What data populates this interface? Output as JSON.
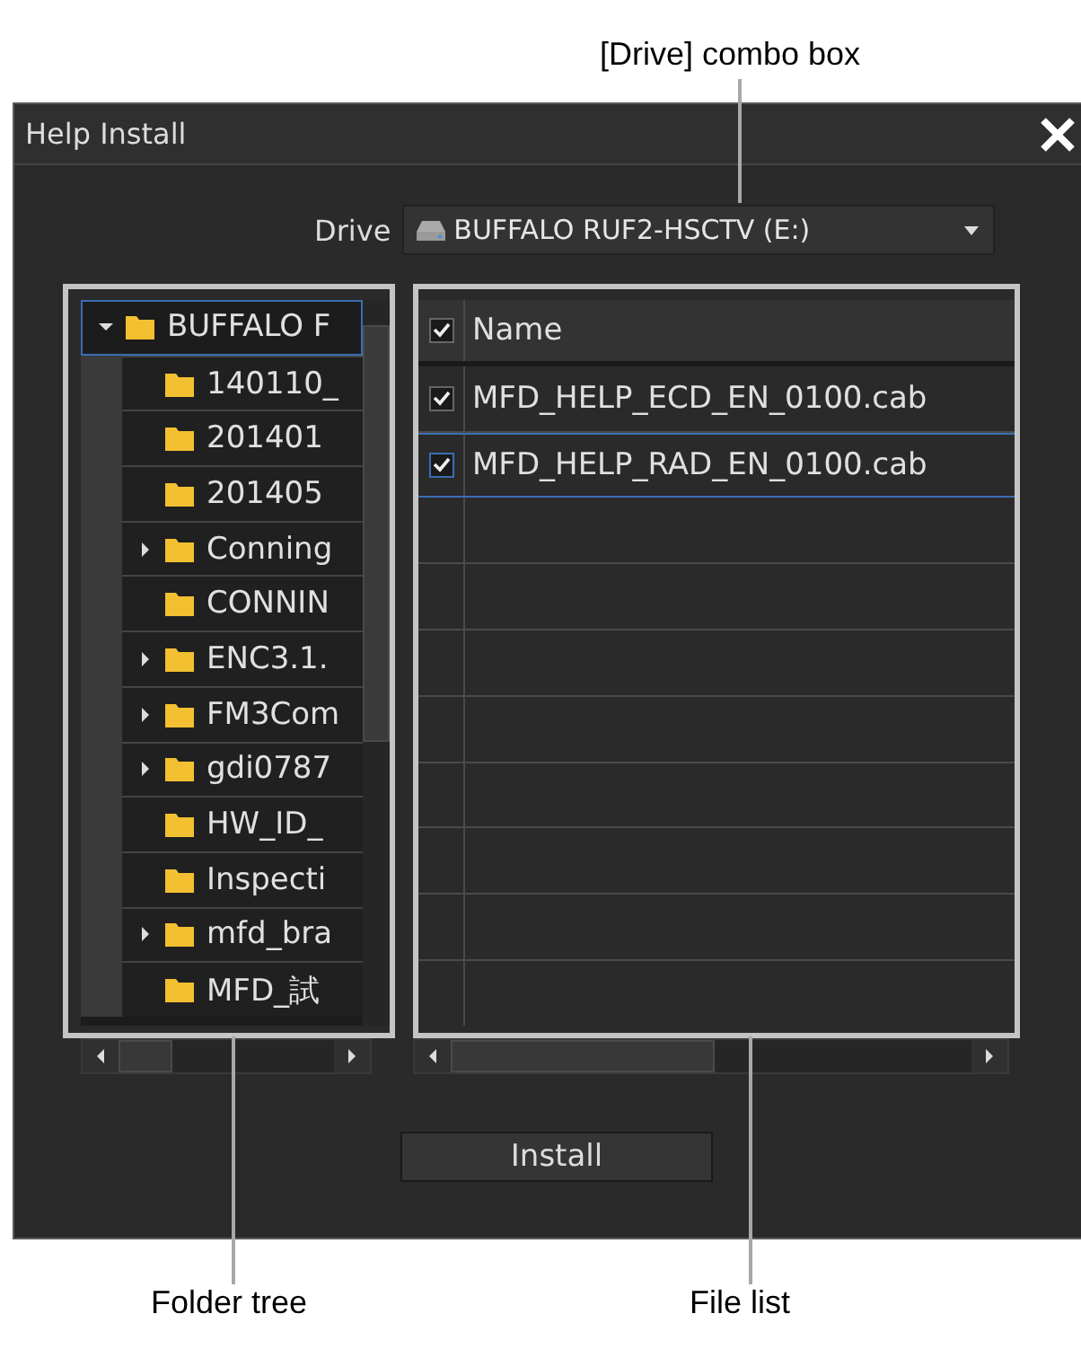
{
  "callouts": {
    "drive": "[Drive] combo box",
    "folder_tree": "Folder tree",
    "file_list": "File list"
  },
  "window": {
    "title": "Help Install"
  },
  "drive": {
    "label": "Drive",
    "value": "BUFFALO RUF2-HSCTV (E:)"
  },
  "folder_tree": {
    "items": [
      {
        "label": "BUFFALO F",
        "expandable": true,
        "expanded": true,
        "selected": true,
        "children": [
          {
            "label": "140110_",
            "expandable": false,
            "selected": false
          },
          {
            "label": "201401",
            "expandable": false,
            "selected": false
          },
          {
            "label": "201405",
            "expandable": false,
            "selected": false
          },
          {
            "label": "Conning",
            "expandable": true,
            "selected": false
          },
          {
            "label": "CONNIN",
            "expandable": false,
            "selected": false
          },
          {
            "label": "ENC3.1.",
            "expandable": true,
            "selected": false
          },
          {
            "label": "FM3Com",
            "expandable": true,
            "selected": false
          },
          {
            "label": "gdi0787",
            "expandable": true,
            "selected": false
          },
          {
            "label": "HW_ID_",
            "expandable": false,
            "selected": false
          },
          {
            "label": "Inspecti",
            "expandable": false,
            "selected": false
          },
          {
            "label": "mfd_bra",
            "expandable": true,
            "selected": false
          },
          {
            "label": "MFD_試",
            "expandable": false,
            "selected": false
          }
        ]
      }
    ]
  },
  "file_list": {
    "header": {
      "label": "Name",
      "checked": true
    },
    "rows": [
      {
        "name": "MFD_HELP_ECD_EN_0100.cab",
        "checked": true,
        "selected": false
      },
      {
        "name": "MFD_HELP_RAD_EN_0100.cab",
        "checked": true,
        "selected": true
      }
    ]
  },
  "buttons": [
    {
      "label": "Install"
    }
  ]
}
